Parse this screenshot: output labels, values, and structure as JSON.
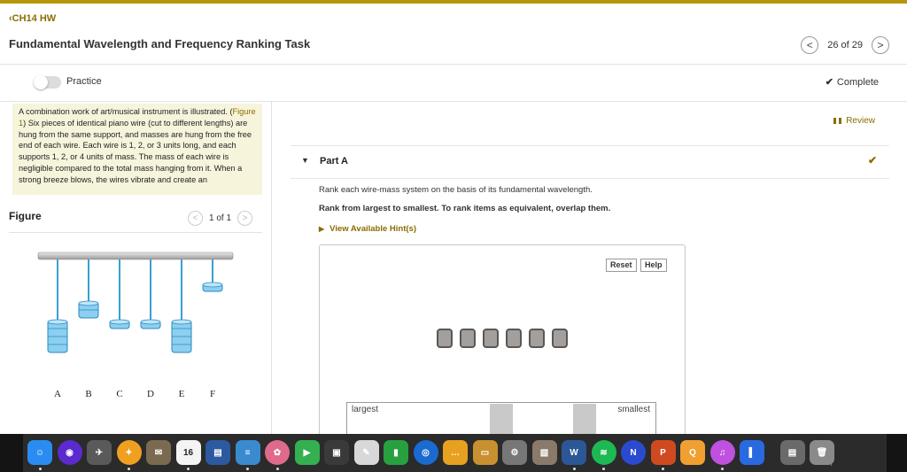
{
  "header": {
    "back_link": "CH14 HW",
    "title": "Fundamental Wavelength and Frequency Ranking Task",
    "pager": "26 of 29",
    "prev_glyph": "<",
    "next_glyph": ">"
  },
  "mode_bar": {
    "practice_label": "Practice",
    "complete_label": "Complete"
  },
  "intro": {
    "text_before": "A combination work of art/musical instrument is illustrated. (",
    "figure_link": "Figure 1",
    "text_after": ") Six pieces of identical piano wire (cut to different lengths) are hung from the same support, and masses are hung from the free end of each wire. Each wire is 1, 2, or 3 units long, and each supports 1, 2, or 4 units of mass. The mass of each wire is negligible compared to the total mass hanging from it. When a strong breeze blows, the wires vibrate and create an"
  },
  "figure": {
    "label": "Figure",
    "pager": "1 of 1",
    "wires": [
      {
        "name": "A",
        "length_units": 3,
        "mass_units": 4
      },
      {
        "name": "B",
        "length_units": 2,
        "mass_units": 2
      },
      {
        "name": "C",
        "length_units": 3,
        "mass_units": 1
      },
      {
        "name": "D",
        "length_units": 3,
        "mass_units": 1
      },
      {
        "name": "E",
        "length_units": 3,
        "mass_units": 4
      },
      {
        "name": "F",
        "length_units": 1,
        "mass_units": 1
      }
    ]
  },
  "review_label": "Review",
  "part_a": {
    "label": "Part A",
    "question": "Rank each wire-mass system on the basis of its fundamental wavelength.",
    "instructions": "Rank from largest to smallest. To rank items as equivalent, overlap them.",
    "hints_label": "View Available Hint(s)",
    "reset_label": "Reset",
    "help_label": "Help",
    "tile_count": 6,
    "largest_label": "largest",
    "smallest_label": "smallest"
  },
  "dock": {
    "items": [
      {
        "name": "finder",
        "glyph": "☺",
        "color": "#2a8cf0"
      },
      {
        "name": "siri",
        "glyph": "◉",
        "color": "#5b2bd0"
      },
      {
        "name": "launchpad",
        "glyph": "✈",
        "color": "#5a5a5a"
      },
      {
        "name": "safari",
        "glyph": "✦",
        "color": "#f0a020"
      },
      {
        "name": "mail",
        "glyph": "✉",
        "color": "#7a6a50"
      },
      {
        "name": "calendar",
        "glyph": "16",
        "color": "#f4f4f4"
      },
      {
        "name": "notebook",
        "glyph": "▤",
        "color": "#2c5aa0"
      },
      {
        "name": "notes",
        "glyph": "≡",
        "color": "#3a8ad0"
      },
      {
        "name": "photos",
        "glyph": "✿",
        "color": "#e06a8a"
      },
      {
        "name": "facetime",
        "glyph": "▶",
        "color": "#34b050"
      },
      {
        "name": "photo-booth",
        "glyph": "▣",
        "color": "#3a3a3a"
      },
      {
        "name": "script-editor",
        "glyph": "✎",
        "color": "#d8d8d8"
      },
      {
        "name": "numbers",
        "glyph": "▮",
        "color": "#28a040"
      },
      {
        "name": "dictionary",
        "glyph": "◎",
        "color": "#1a6ad0"
      },
      {
        "name": "messages",
        "glyph": "…",
        "color": "#e8a020"
      },
      {
        "name": "keynote",
        "glyph": "▭",
        "color": "#c89030"
      },
      {
        "name": "system-preferences",
        "glyph": "⚙",
        "color": "#777777"
      },
      {
        "name": "preview",
        "glyph": "▧",
        "color": "#8a7a6a"
      },
      {
        "name": "word",
        "glyph": "W",
        "color": "#2b5797"
      },
      {
        "name": "spotify",
        "glyph": "≋",
        "color": "#1db954"
      },
      {
        "name": "noteshelf",
        "glyph": "N",
        "color": "#2c4ad0"
      },
      {
        "name": "powerpoint",
        "glyph": "P",
        "color": "#d04a20"
      },
      {
        "name": "quicktime",
        "glyph": "Q",
        "color": "#f0a030"
      },
      {
        "name": "itunes",
        "glyph": "♫",
        "color": "#c050e0"
      },
      {
        "name": "onenote-blue",
        "glyph": "▌",
        "color": "#2a6ae0"
      },
      {
        "name": "printer",
        "glyph": "▤",
        "color": "#6a6a6a"
      },
      {
        "name": "trash",
        "glyph": "🗑",
        "color": "#8a8a8a"
      }
    ],
    "calendar_badge": "16",
    "settings_badge": "1"
  }
}
